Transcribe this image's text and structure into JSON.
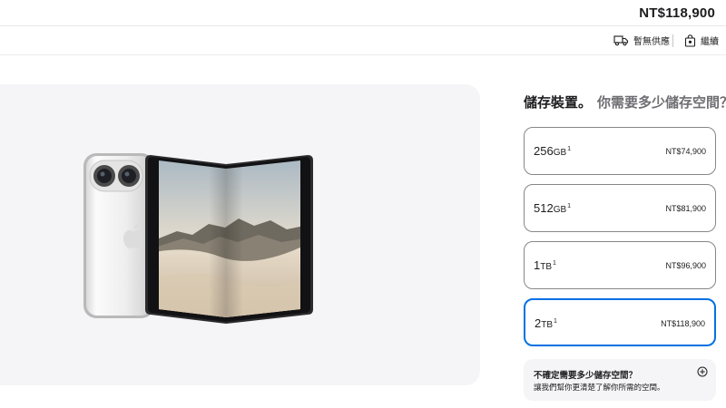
{
  "header": {
    "total_price": "NT$118,900"
  },
  "subbar": {
    "delivery_label": "暫無供應",
    "continue_label": "繼續"
  },
  "storage": {
    "title": "儲存裝置。",
    "subtitle": "你需要多少儲存空間？",
    "options": [
      {
        "capacity": "256",
        "unit": "GB",
        "footnote": "1",
        "price": "NT$74,900",
        "selected": false
      },
      {
        "capacity": "512",
        "unit": "GB",
        "footnote": "1",
        "price": "NT$81,900",
        "selected": false
      },
      {
        "capacity": "1",
        "unit": "TB",
        "footnote": "1",
        "price": "NT$96,900",
        "selected": false
      },
      {
        "capacity": "2",
        "unit": "TB",
        "footnote": "1",
        "price": "NT$118,900",
        "selected": true
      }
    ],
    "help": {
      "title": "不確定需要多少儲存空間？",
      "text": "讓我們幫你更清楚了解你所需的空間。"
    }
  },
  "icons": {
    "delivery": "truck-icon",
    "continue": "bag-icon",
    "help_expand": "plus-circle-icon"
  },
  "colors": {
    "accent": "#0071e3",
    "panel_bg": "#f5f5f7",
    "text": "#1d1d1f",
    "muted": "#6e6e73"
  }
}
